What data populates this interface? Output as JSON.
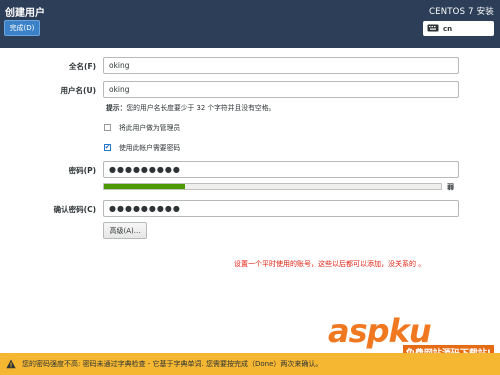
{
  "header": {
    "title": "创建用户",
    "done_button": "完成(D)",
    "os_title": "CENTOS 7 安装",
    "keyboard_layout": "cn"
  },
  "form": {
    "fullname_label": "全名(F)",
    "fullname_value": "oking",
    "username_label": "用户名(U)",
    "username_value": "oking",
    "hint_prefix": "提示：",
    "hint_text": "您的用户名长度要少于 32 个字符并且没有空格。",
    "admin_checkbox_label": "将此用户做为管理员",
    "admin_checked": false,
    "require_password_label": "使用此帐户需要密码",
    "require_password_checked": true,
    "password_label": "密码(P)",
    "password_value": "●●●●●●●●●",
    "strength_text": "弱",
    "strength_level": 0.24,
    "strength_color": "#4e9a06",
    "confirm_label": "确认密码(C)",
    "confirm_value": "●●●●●●●●●",
    "advanced_button": "高级(A)..."
  },
  "annotation": {
    "text": "设置一个平时使用的账号，这些以后都可以添加，没关系的 。",
    "color": "#e02010"
  },
  "watermark": {
    "brand": "aspku",
    "tagline": "免费网站源码下载站!"
  },
  "warning": {
    "text": "您的密码强度不高: 密码未通过字典检查 - 它基于字典单词. 您需要按完成（Done）两次来确认。",
    "icon": "warning-icon"
  },
  "colors": {
    "header_bg": "#2c3e58",
    "accent": "#3b81c7",
    "warning_bg": "#f5b731"
  }
}
